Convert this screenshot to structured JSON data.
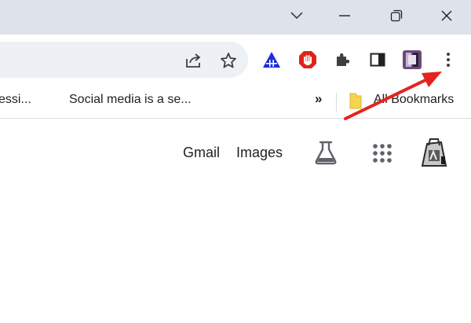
{
  "bookmarks": {
    "items": [
      {
        "label": "essi..."
      },
      {
        "label": "Social media is a se..."
      }
    ],
    "overflow_label": "»",
    "all_bookmarks_label": "All Bookmarks"
  },
  "google_header": {
    "gmail_label": "Gmail",
    "images_label": "Images"
  },
  "icons": {
    "minimize": "minimize-icon",
    "restore": "restore-icon",
    "close": "close-icon",
    "tab_search": "chevron-down-icon",
    "share": "share-icon",
    "bookmark_star": "star-icon",
    "menu": "kebab-menu-icon",
    "labs": "flask-icon",
    "apps": "apps-grid-icon"
  },
  "colors": {
    "titlebar": "#dee3ea",
    "omnibox": "#edf1f6",
    "arrow": "#e5231b",
    "adblock": "#e0241b",
    "folder": "#f6d54d"
  }
}
